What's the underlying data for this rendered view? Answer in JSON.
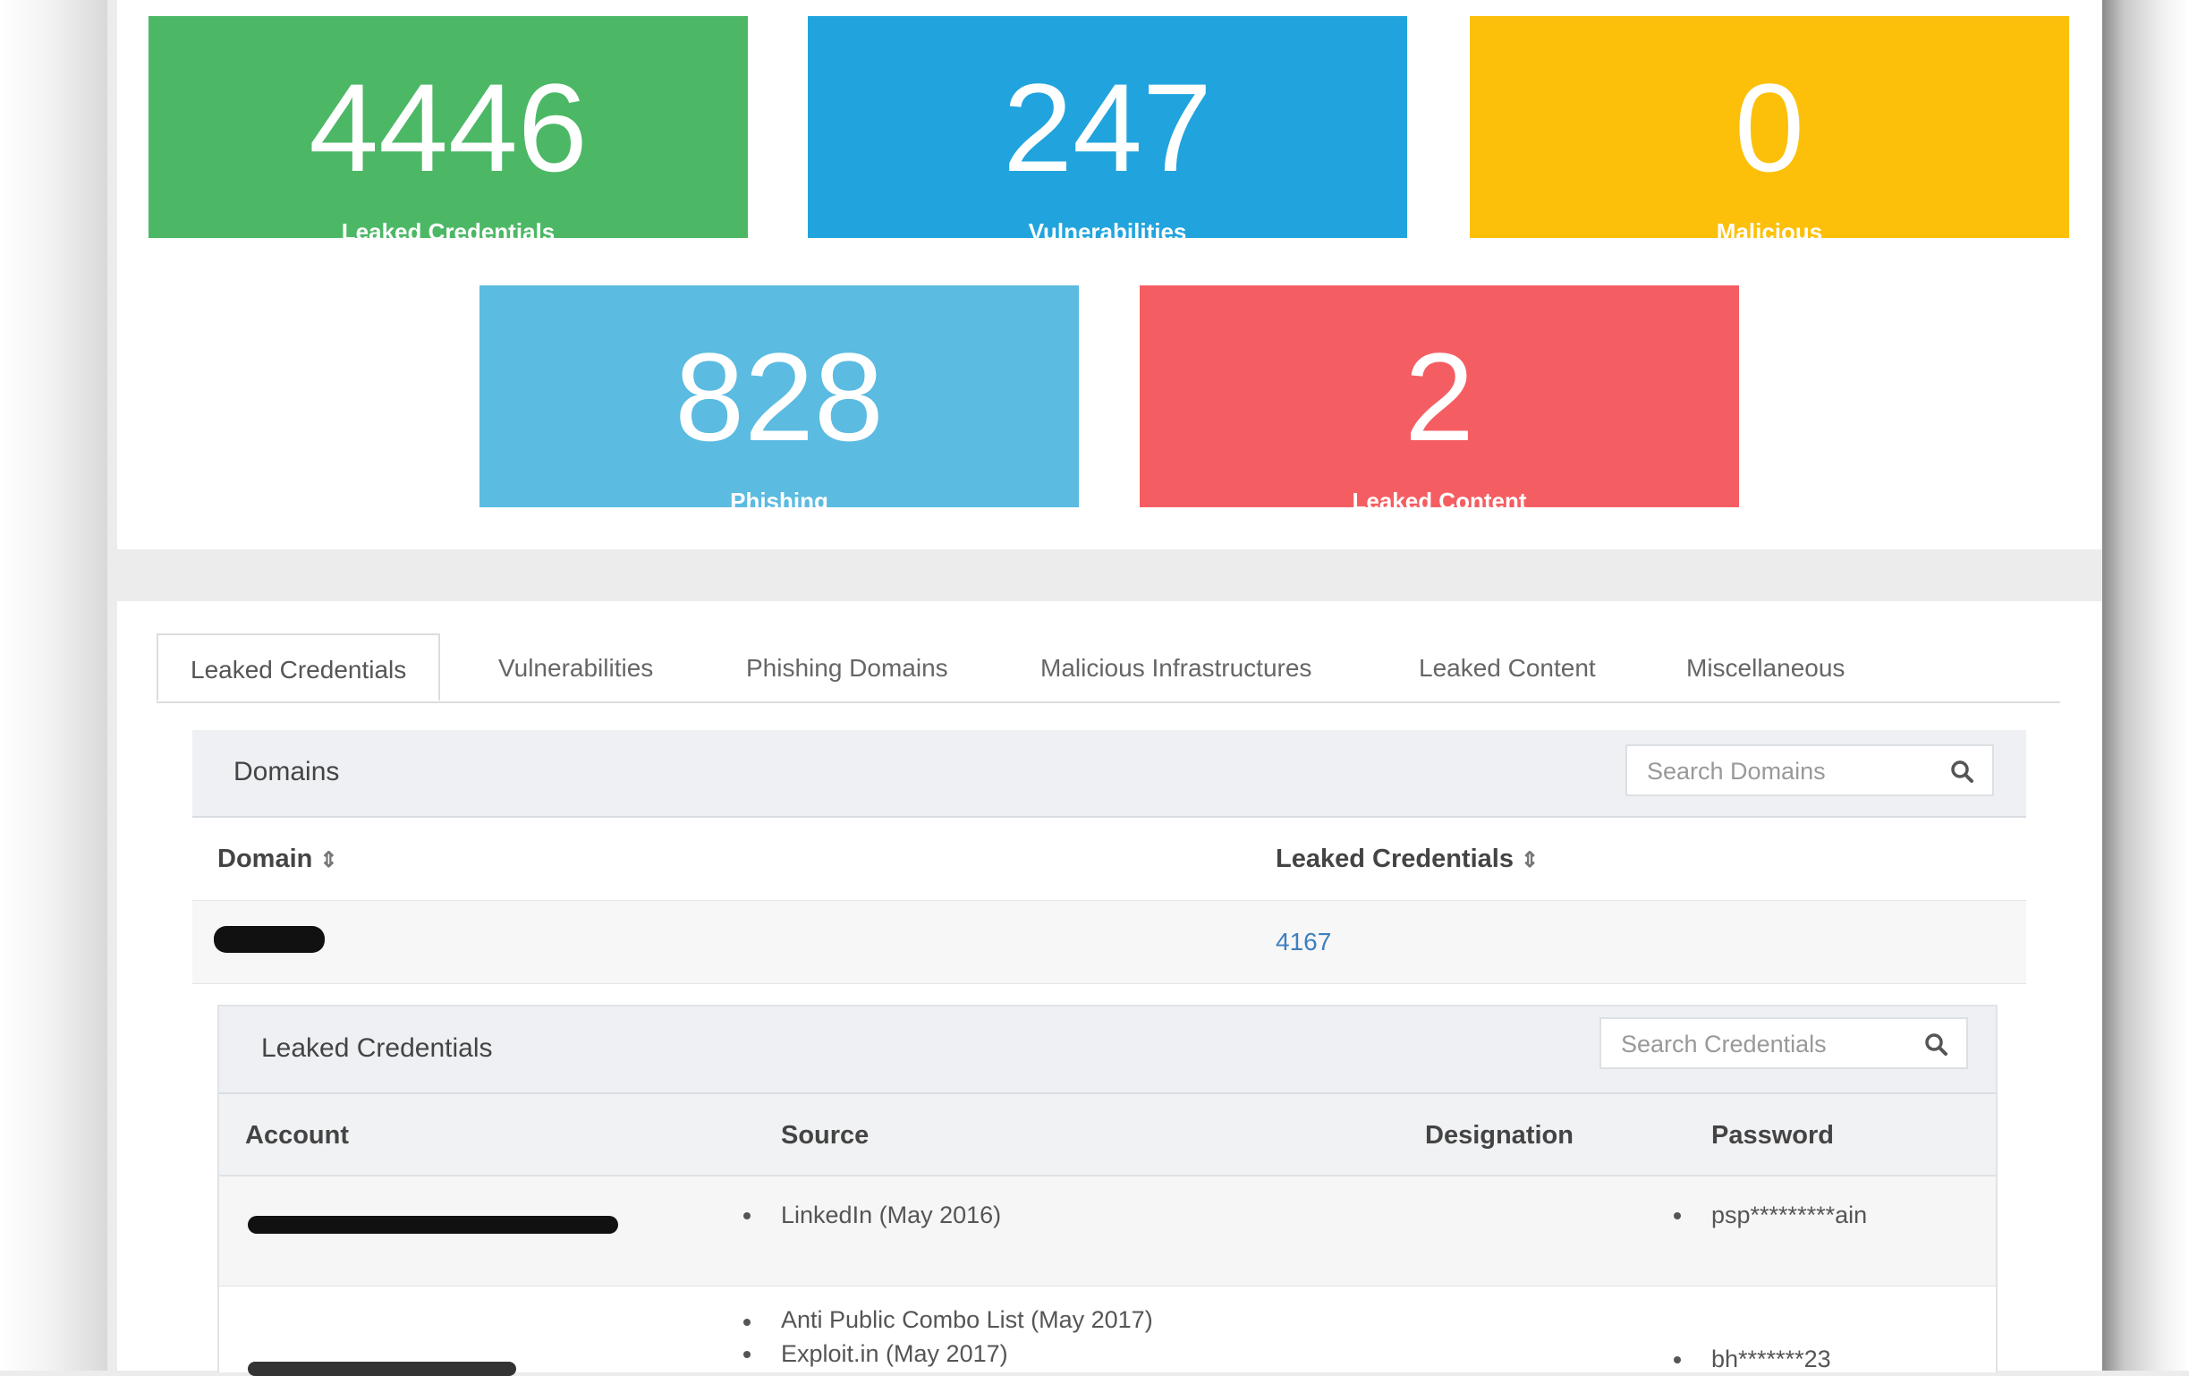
{
  "stats": [
    {
      "value": "4446",
      "label": "Leaked Credentials",
      "color": "#4cb866"
    },
    {
      "value": "247",
      "label": "Vulnerabilities",
      "color": "#21a4dd"
    },
    {
      "value": "0",
      "label": "Malicious",
      "color": "#fcc00a"
    },
    {
      "value": "828",
      "label": "Phishing",
      "color": "#5bbbe1"
    },
    {
      "value": "2",
      "label": "Leaked Content",
      "color": "#f45e62"
    }
  ],
  "tabs": [
    "Leaked Credentials",
    "Vulnerabilities",
    "Phishing Domains",
    "Malicious Infrastructures",
    "Leaked Content",
    "Miscellaneous"
  ],
  "domains": {
    "title": "Domains",
    "search_placeholder": "Search Domains",
    "columns": {
      "domain": "Domain",
      "leaked": "Leaked Credentials"
    },
    "rows": [
      {
        "domain": "[redacted]",
        "leaked": "4167"
      }
    ]
  },
  "credentials": {
    "title": "Leaked Credentials",
    "search_placeholder": "Search Credentials",
    "columns": {
      "account": "Account",
      "source": "Source",
      "designation": "Designation",
      "password": "Password"
    },
    "rows": [
      {
        "account": "[redacted]",
        "sources": [
          "LinkedIn (May 2016)"
        ],
        "designation": "",
        "password": "psp*********ain"
      },
      {
        "account": "[redacted]",
        "sources": [
          "Anti Public Combo List (May 2017)",
          "Exploit.in (May 2017)"
        ],
        "designation": "",
        "password": "bh*******23"
      }
    ]
  },
  "icons": {
    "search": "search-icon",
    "sort": "sort-icon"
  }
}
